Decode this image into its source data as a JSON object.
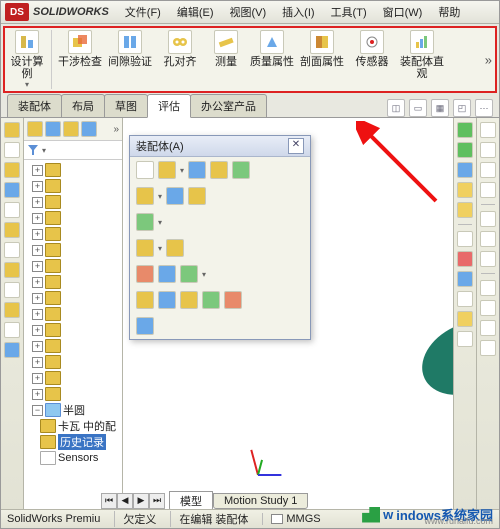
{
  "brand": "SOLIDWORKS",
  "menus": [
    "文件(F)",
    "编辑(E)",
    "视图(V)",
    "插入(I)",
    "工具(T)",
    "窗口(W)",
    "帮助"
  ],
  "ribbon": [
    {
      "label": "设计算例",
      "dd": true
    },
    {
      "label": "干涉检查"
    },
    {
      "label": "间隙验证"
    },
    {
      "label": "孔对齐"
    },
    {
      "label": "测量"
    },
    {
      "label": "质量属性"
    },
    {
      "label": "剖面属性"
    },
    {
      "label": "传感器"
    },
    {
      "label": "装配体直观"
    }
  ],
  "tabs": {
    "items": [
      "装配体",
      "布局",
      "草图",
      "评估",
      "办公室产品"
    ],
    "active": 3
  },
  "popup": {
    "title": "装配体(A)"
  },
  "tree": {
    "items": [
      {
        "label": "半圆"
      },
      {
        "label": "卡瓦 中的配"
      },
      {
        "label": "历史记录",
        "sel": true
      },
      {
        "label": "Sensors"
      }
    ]
  },
  "doctabs": {
    "items": [
      "模型",
      "Motion Study 1"
    ],
    "active": 0
  },
  "status": {
    "app": "SolidWorks Premiu",
    "c1": "欠定义",
    "c2": "在编辑 装配体",
    "units": "MMGS"
  },
  "watermark": {
    "main": "indows系统家园",
    "sub": "www.ruhaifu.com"
  }
}
